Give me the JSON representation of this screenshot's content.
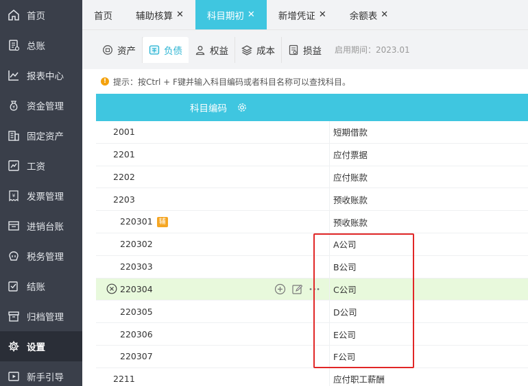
{
  "sidebar": {
    "items": [
      {
        "label": "首页",
        "icon": "home-icon"
      },
      {
        "label": "总账",
        "icon": "ledger-icon"
      },
      {
        "label": "报表中心",
        "icon": "chart-icon"
      },
      {
        "label": "资金管理",
        "icon": "money-bag-icon"
      },
      {
        "label": "固定资产",
        "icon": "building-icon"
      },
      {
        "label": "工资",
        "icon": "salary-icon"
      },
      {
        "label": "发票管理",
        "icon": "invoice-icon"
      },
      {
        "label": "进销台账",
        "icon": "inventory-icon"
      },
      {
        "label": "税务管理",
        "icon": "tax-icon"
      },
      {
        "label": "结账",
        "icon": "checkout-icon"
      },
      {
        "label": "归档管理",
        "icon": "archive-icon"
      },
      {
        "label": "设置",
        "icon": "gear-icon",
        "active": true
      },
      {
        "label": "新手引导",
        "icon": "play-icon"
      }
    ]
  },
  "tabs": [
    {
      "label": "首页",
      "closable": false
    },
    {
      "label": "辅助核算",
      "closable": true
    },
    {
      "label": "科目期初",
      "closable": true,
      "active": true
    },
    {
      "label": "新增凭证",
      "closable": true
    },
    {
      "label": "余额表",
      "closable": true
    }
  ],
  "subtabs": [
    {
      "label": "资产",
      "icon": "asset-icon"
    },
    {
      "label": "负债",
      "icon": "liability-icon",
      "active": true
    },
    {
      "label": "权益",
      "icon": "equity-icon"
    },
    {
      "label": "成本",
      "icon": "cost-icon"
    },
    {
      "label": "损益",
      "icon": "profit-loss-icon"
    }
  ],
  "period": "启用期间：2023.01",
  "tip": "提示：按Ctrl + F键并输入科目编码或者科目名称可以查找科目。",
  "table": {
    "header": "科目编码",
    "rows": [
      {
        "code": "2001",
        "name": "短期借款",
        "level": 1
      },
      {
        "code": "2201",
        "name": "应付票据",
        "level": 1
      },
      {
        "code": "2202",
        "name": "应付账款",
        "level": 1
      },
      {
        "code": "2203",
        "name": "预收账款",
        "level": 1
      },
      {
        "code": "220301",
        "name": "预收账款",
        "level": 2,
        "badge": "辅"
      },
      {
        "code": "220302",
        "name": "A公司",
        "level": 2
      },
      {
        "code": "220303",
        "name": "B公司",
        "level": 2
      },
      {
        "code": "220304",
        "name": "C公司",
        "level": 2,
        "highlight": true
      },
      {
        "code": "220305",
        "name": "D公司",
        "level": 2
      },
      {
        "code": "220306",
        "name": "E公司",
        "level": 2
      },
      {
        "code": "220307",
        "name": "F公司",
        "level": 2
      },
      {
        "code": "2211",
        "name": "应付职工薪酬",
        "level": 1
      }
    ]
  },
  "colors": {
    "accent": "#3fc6e0",
    "sidebar": "#3a3f4a",
    "highlight_row": "#e8f9dc",
    "annotation_box": "#e12626"
  }
}
